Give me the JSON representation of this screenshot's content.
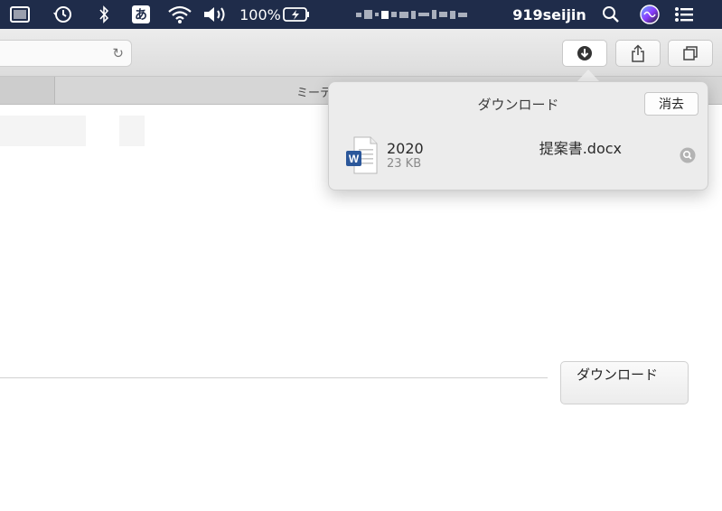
{
  "menubar": {
    "ime_label": "あ",
    "battery_percent": "100%",
    "username": "919seijin",
    "icons": [
      "screen-icon",
      "time-machine-icon",
      "bluetooth-icon",
      "input-method-icon",
      "wifi-icon",
      "volume-icon",
      "battery-charging-icon",
      "spotlight-icon",
      "siri-icon",
      "control-center-icon"
    ]
  },
  "toolbar": {
    "reload_glyph": "↻",
    "buttons": [
      "downloads-button",
      "share-button",
      "tabs-overview-button"
    ]
  },
  "tabs": {
    "active_title": "ミーテ"
  },
  "downloads_popover": {
    "title": "ダウンロード",
    "clear_label": "消去",
    "items": [
      {
        "name": "2020　　　　　　　　提案書.docx",
        "size": "23 KB",
        "icon": "word-doc-icon"
      }
    ]
  },
  "page": {
    "download_button_label": "ダウンロード"
  },
  "colors": {
    "menubar_bg": "#1f2c4a",
    "popover_bg": "#ececec",
    "word_blue": "#2b579a"
  }
}
